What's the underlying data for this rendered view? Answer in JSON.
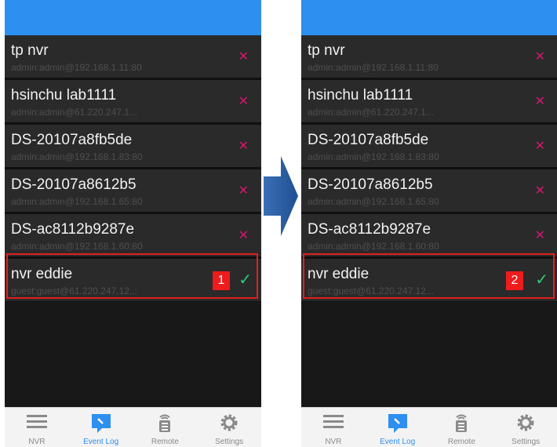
{
  "colors": {
    "accent": "#2d8ff0",
    "delete": "#d3186f",
    "check": "#2ecc71",
    "badge": "#ee1c1c"
  },
  "nvr_list": [
    {
      "name": "tp nvr",
      "sub": "admin:admin@192.168.1.11:80"
    },
    {
      "name": "hsinchu lab1111",
      "sub": "admin:admin@61.220.247.1..."
    },
    {
      "name": "DS-20107a8fb5de",
      "sub": "admin:admin@192.168.1.83:80"
    },
    {
      "name": "DS-20107a8612b5",
      "sub": "admin:admin@192.168.1.65:80"
    },
    {
      "name": "DS-ac8112b9287e",
      "sub": "admin:admin@192.168.1.60:80"
    },
    {
      "name": "nvr eddie",
      "sub": "guest:guest@61.220.247.12..."
    }
  ],
  "panels": {
    "left": {
      "badge": "1"
    },
    "right": {
      "badge": "2"
    }
  },
  "tabs": [
    {
      "label": "NVR",
      "icon": "list-icon"
    },
    {
      "label": "Event Log",
      "icon": "event-log-icon",
      "active": true
    },
    {
      "label": "Remote",
      "icon": "remote-icon"
    },
    {
      "label": "Settings",
      "icon": "gear-icon"
    }
  ]
}
